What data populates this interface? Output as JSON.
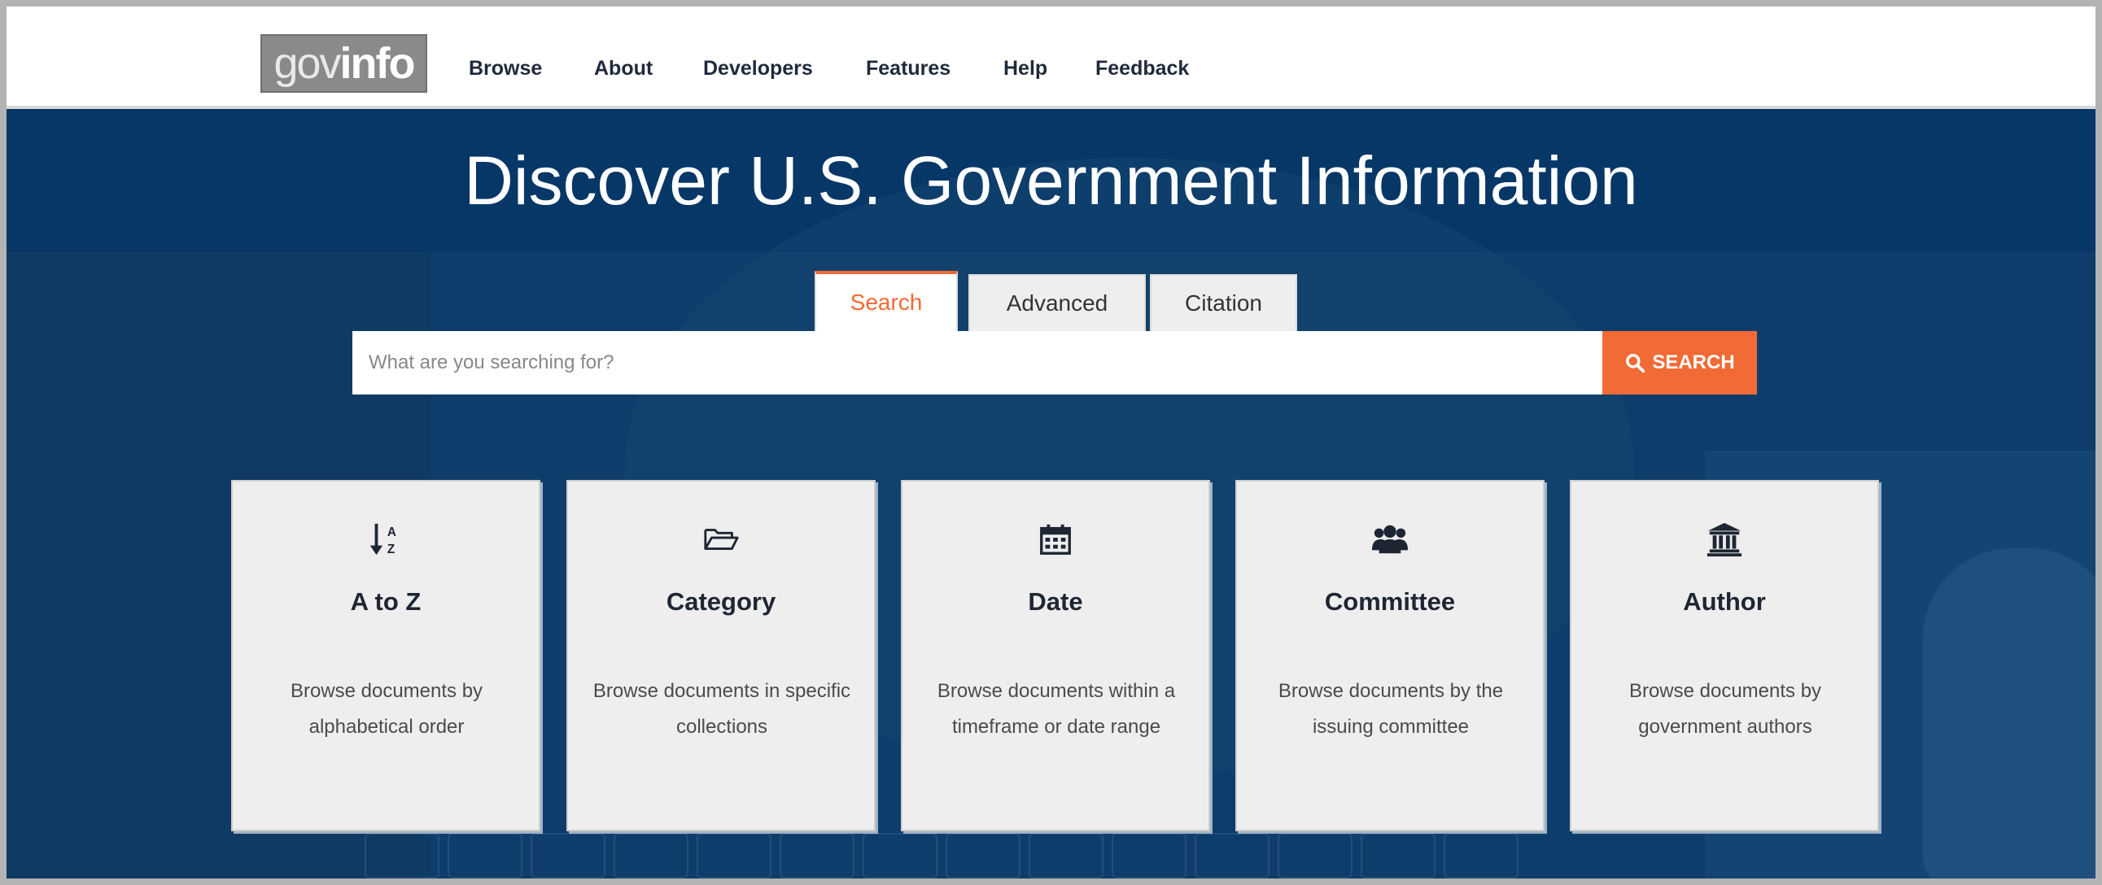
{
  "logo": {
    "part1": "gov",
    "part2": "info"
  },
  "nav": {
    "items": [
      "Browse",
      "About",
      "Developers",
      "Features",
      "Help",
      "Feedback"
    ]
  },
  "hero": {
    "title": "Discover U.S. Government Information"
  },
  "search": {
    "tabs": [
      "Search",
      "Advanced",
      "Citation"
    ],
    "active_tab": "Search",
    "placeholder": "What are you searching for?",
    "button_label": "SEARCH"
  },
  "cards": [
    {
      "icon": "sort-alpha-icon",
      "title": "A to Z",
      "desc": "Browse documents by alphabetical order"
    },
    {
      "icon": "folder-open-icon",
      "title": "Category",
      "desc": "Browse documents in specific collections"
    },
    {
      "icon": "calendar-icon",
      "title": "Date",
      "desc": "Browse documents within a timeframe or date range"
    },
    {
      "icon": "users-icon",
      "title": "Committee",
      "desc": "Browse documents by the issuing committee"
    },
    {
      "icon": "institution-icon",
      "title": "Author",
      "desc": "Browse documents by government authors"
    }
  ],
  "colors": {
    "brand_navy": "#063767",
    "accent_orange": "#f26a35",
    "card_bg": "#eeeeee",
    "logo_gray": "#8a8a8a"
  }
}
